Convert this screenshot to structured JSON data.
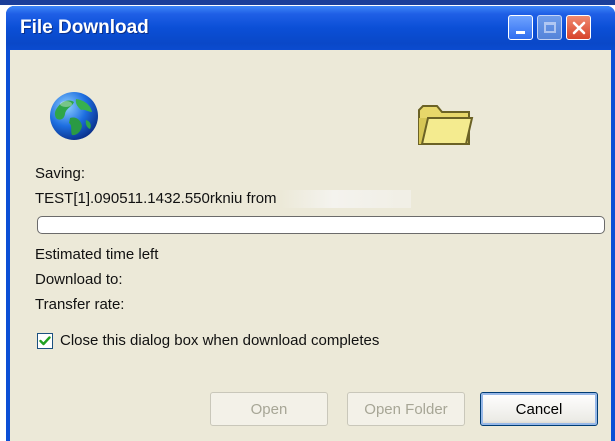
{
  "window": {
    "title": "File Download"
  },
  "titlebar_buttons": [
    "minimize",
    "maximize",
    "close"
  ],
  "icons": {
    "globe": "globe-icon",
    "folder": "folder-icon"
  },
  "content": {
    "saving_label": "Saving:",
    "filename": "TEST[1].090511.1432.550rkniu from",
    "progress_percent": 0,
    "estimated_time_label": "Estimated time left",
    "download_to_label": "Download to:",
    "transfer_rate_label": "Transfer rate:"
  },
  "checkbox": {
    "label": "Close this dialog box when download completes",
    "checked": true
  },
  "buttons": {
    "open": "Open",
    "open_folder": "Open Folder",
    "cancel": "Cancel"
  },
  "colors": {
    "titlebar": "#0b4fd6",
    "dialog_bg": "#ece9d8",
    "checkmark": "#21a121"
  }
}
